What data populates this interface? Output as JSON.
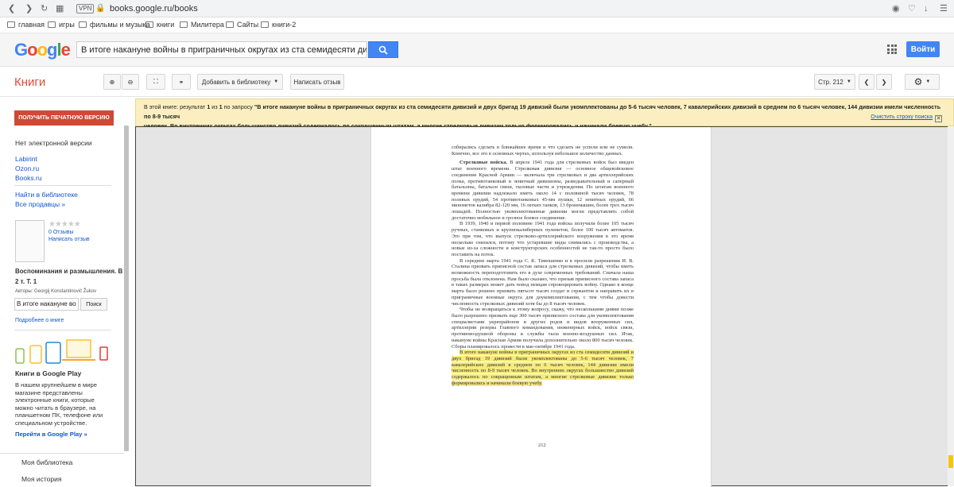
{
  "browser": {
    "url": "books.google.ru/books",
    "vpn_label": "VPN",
    "nav_icons": [
      "back-icon",
      "forward-icon",
      "reload-icon",
      "grid-icon"
    ],
    "right_icons": [
      "camera-icon",
      "heart-icon",
      "download-icon",
      "menu-icon"
    ]
  },
  "bookmarks": [
    {
      "label": "главная"
    },
    {
      "label": "игры"
    },
    {
      "label": "фильмы и музыка"
    },
    {
      "label": "книги"
    },
    {
      "label": "Милитера"
    },
    {
      "label": "Сайты"
    },
    {
      "label": "книги-2"
    }
  ],
  "header": {
    "search_value": "В итоге накануне войны в приграничных округах из ста семидесяти дивизий и",
    "signin_label": "Войти"
  },
  "toolbar": {
    "section_title": "Книги",
    "add_library_label": "Добавить в библиотеку",
    "write_review_label": "Написать отзыв",
    "page_label": "Стр. 212"
  },
  "snippet": {
    "prefix": "В этой книге: результат ",
    "result": "1",
    "middle": " из ",
    "total": "1",
    "query_prefix": " по запросу ",
    "query_line1": "\"В итоге накануне войны в приграничных округах из ста семидесяти дивизий и двух бригад 19 дивизий были укомплектованы до 5-6 тысяч человек, 7 кавалерийских дивизий в среднем по 6 тысяч человек, 144 дивизии имели численность по 8-9 тысяч",
    "query_line2": "человек. Во внутренних округах большинство дивизий содержалось по сокращенным штатам, а многие стрелковые дивизии только формировались и начинали боевую учебу.\"",
    "clear_link": "Очистить строку поиска"
  },
  "sidebar": {
    "print_button": "ПОЛУЧИТЬ ПЕЧАТНУЮ ВЕРСИЮ",
    "no_ebook": "Нет электронной версии",
    "stores": [
      "Labirint",
      "Ozon.ru",
      "Books.ru"
    ],
    "find_library": "Найти в библиотеке",
    "all_sellers": "Все продавцы »",
    "reviews_count": "0 Отзывы",
    "write_review": "Написать отзыв",
    "book_title_1": "Воспоминания и размышления. В",
    "book_title_2": "2 т. Т. 1",
    "authors": "Авторы: Georgij Konstantinovič Žukov",
    "inbook_value": "В итоге накануне во",
    "inbook_button": "Поиск",
    "about_book": "Подробнее о книге",
    "play_title": "Книги в Google Play",
    "play_desc": "В нашем крупнейшем в мире магазине представлены электронные книги, которые можно читать в браузере, на планшетном ПК, телефоне или специальном устройстве.",
    "play_link": "Перейти в Google Play »",
    "my_library": "Моя библиотека",
    "my_history": "Моя история"
  },
  "book_page": {
    "page_number": "212",
    "p1": "собирались сделать в ближайшее время и что сделать не успели или не сумели. Конечно, все это в основных чертах, используя небольшое количество данных.",
    "p2_heading": "Стрелковые войска.",
    "p2": " В апреле 1941 года для стрелковых войск был введен штат военного времени. Стрелковая дивизия — основное общевойсковое соединение Красной Армии — включала три стрелковых и два артиллерийских полка, противотанковый и зенитный дивизионы, разведывательный и саперный батальоны, батальон связи, тыловые части и учреждения. По штатам военного времени дивизии надлежало иметь около 14 с половиной тысяч человек, 78 полевых орудий, 54 противотанковых 45-мм пушки, 12 зенитных орудий, 66 минометов калибра 82-120 мм, 16 легких танков, 13 бронемашин, более трех тысяч лошадей. Полностью укомплектованные дивизии могли представлять собой достаточно мобильное и грозное боевое соединение.",
    "p3": "В 1939, 1940 и первой половине 1941 года войска получили более 105 тысяч ручных, станковых и крупнокалиберных пулеметов, более 100 тысяч автоматов. Это при том, что выпуск стрелково-артиллерийского вооружения в это время несколько снизился, потому что устаревшие виды снимались с производства, а новые из-за сложности и конструкторских особенностей не так-то просто было поставить на поток.",
    "p4": "В середине марта 1941 года С. К. Тимошенко и я просили разрешения И. В. Сталина призвать приписной состав запаса для стрелковых дивизий, чтобы иметь возможность переподготовить его в духе современных требований. Сначала наша просьба была отклонена. Нам было сказано, что призыв приписного состава запаса в таких размерах может дать повод немцам спровоцировать войну. Однако в конце марта было решено призвать пятьсот тысяч солдат и сержантов и направить их в приграничные военные округа для доукомплектования, с тем чтобы довести численность стрелковых дивизий хотя бы до 8 тысяч человек.",
    "p5": "Чтобы не возвращаться к этому вопросу, скажу, что несколькими днями позже было разрешено призвать еще 300 тысяч приписного состава для укомплектования специалистами укрепрайонов и других родов и видов вооруженных сил, артиллерии резерва Главного командования, инженерных войск, войск связи, противовоздушной обороны и службы тыла военно-воздушных сил. Итак, накануне войны Красная Армия получила дополнительно около 800 тысяч человек. Сборы планировалось провести в мае-октябре 1941 года.",
    "p6": "В итоге накануне войны в приграничных округах из ста семидесяти дивизий и двух бригад 19 дивизий были укомплектованы до 5-6 тысяч человек, 7 кавалерийских дивизий в среднем по 6 тысяч человек, 144 дивизии имели численность по 8-9 тысяч человек. Во внутренних округах большинство дивизий содержалось по сокращенным штатам, а многие стрелковые дивизии только формировались и начинали боевую учебу."
  },
  "colors": {
    "accent_red": "#dd4b39",
    "google_blue": "#4285f4",
    "highlight": "#f6eb7d",
    "snippet_bg": "#fbefc2"
  }
}
